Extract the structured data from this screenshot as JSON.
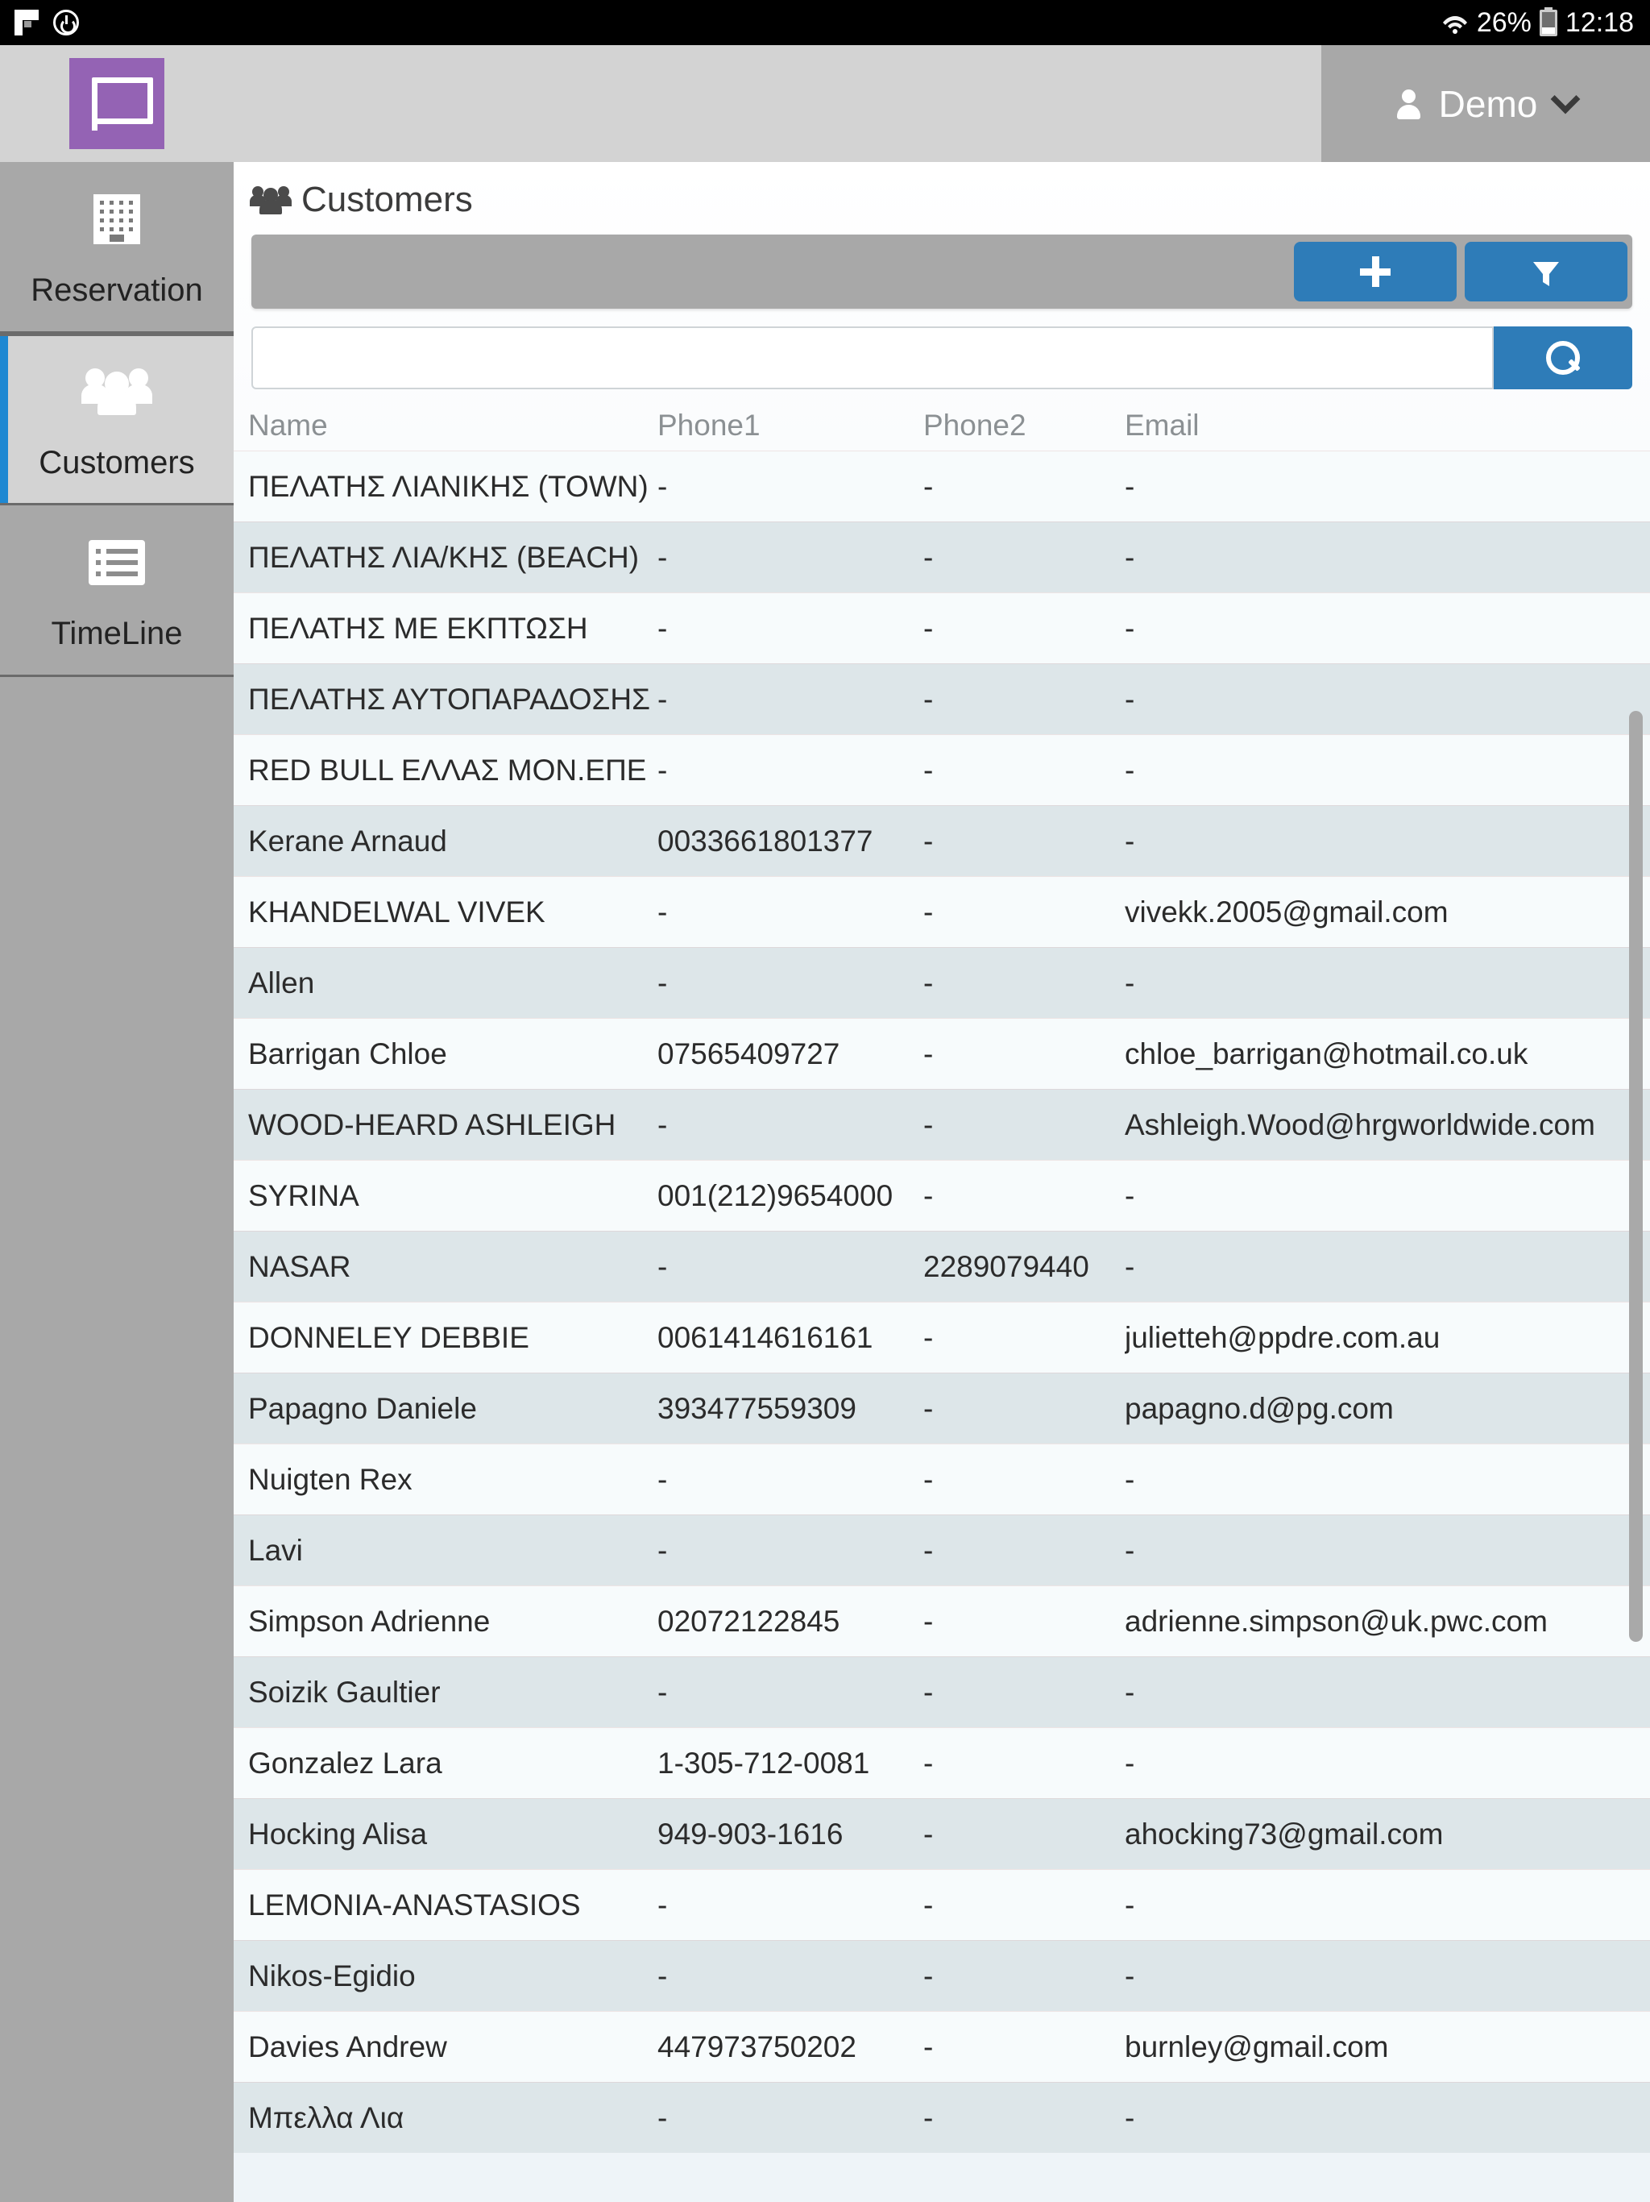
{
  "statusbar": {
    "battery_percent": "26%",
    "time": "12:18",
    "icons": [
      "flag-icon",
      "power-sync-icon",
      "wifi-icon",
      "battery-icon"
    ]
  },
  "appbar": {
    "logo_name": "app-logo",
    "user_label": "Demo",
    "dropdown_icon": "chevron-down-icon"
  },
  "sidebar": {
    "items": [
      {
        "label": "Reservation",
        "icon": "building-icon",
        "active": false
      },
      {
        "label": "Customers",
        "icon": "people-icon",
        "active": true
      },
      {
        "label": "TimeLine",
        "icon": "list-icon",
        "active": false
      }
    ]
  },
  "page": {
    "title": "Customers",
    "title_icon": "people-icon"
  },
  "toolbar": {
    "add_label": "+",
    "add_icon": "plus-icon",
    "filter_icon": "funnel-icon",
    "accent_color": "#2e7cb8"
  },
  "search": {
    "value": "",
    "placeholder": "",
    "button_icon": "search-icon"
  },
  "table": {
    "columns": [
      "Name",
      "Phone1",
      "Phone2",
      "Email"
    ],
    "empty_value": "-",
    "rows": [
      {
        "name": "ΠΕΛΑΤΗΣ ΛΙΑΝΙΚΗΣ (TOWN)",
        "phone1": "-",
        "phone2": "-",
        "email": "-"
      },
      {
        "name": "ΠΕΛΑΤΗΣ ΛΙΑ/ΚΗΣ (BEACH)",
        "phone1": "-",
        "phone2": "-",
        "email": "-"
      },
      {
        "name": "ΠΕΛΑΤΗΣ ΜΕ ΕΚΠΤΩΣΗ",
        "phone1": "-",
        "phone2": "-",
        "email": "-"
      },
      {
        "name": "ΠΕΛΑΤΗΣ ΑΥΤΟΠΑΡΑΔΟΣΗΣ",
        "phone1": "-",
        "phone2": "-",
        "email": "-"
      },
      {
        "name": "RED BULL ΕΛΛΑΣ ΜΟΝ.ΕΠΕ",
        "phone1": "-",
        "phone2": "-",
        "email": "-"
      },
      {
        "name": "Kerane Arnaud",
        "phone1": "0033661801377",
        "phone2": "-",
        "email": "-"
      },
      {
        "name": "KHANDELWAL VIVEK",
        "phone1": "-",
        "phone2": "-",
        "email": "vivekk.2005@gmail.com"
      },
      {
        "name": "Allen",
        "phone1": "-",
        "phone2": "-",
        "email": "-"
      },
      {
        "name": "Barrigan Chloe",
        "phone1": "07565409727",
        "phone2": "-",
        "email": "chloe_barrigan@hotmail.co.uk"
      },
      {
        "name": "WOOD-HEARD ASHLEIGH",
        "phone1": "-",
        "phone2": "-",
        "email": "Ashleigh.Wood@hrgworldwide.com"
      },
      {
        "name": "SYRINA",
        "phone1": "001(212)9654000",
        "phone2": "-",
        "email": "-"
      },
      {
        "name": "NASAR",
        "phone1": "-",
        "phone2": "2289079440",
        "email": "-"
      },
      {
        "name": "DONNELEY DEBBIE",
        "phone1": "0061414616161",
        "phone2": "-",
        "email": "julietteh@ppdre.com.au"
      },
      {
        "name": "Papagno Daniele",
        "phone1": "393477559309",
        "phone2": "-",
        "email": "papagno.d@pg.com"
      },
      {
        "name": "Nuigten Rex",
        "phone1": "-",
        "phone2": "-",
        "email": "-"
      },
      {
        "name": "Lavi",
        "phone1": "-",
        "phone2": "-",
        "email": "-"
      },
      {
        "name": "Simpson Adrienne",
        "phone1": "02072122845",
        "phone2": "-",
        "email": "adrienne.simpson@uk.pwc.com"
      },
      {
        "name": "Soizik Gaultier",
        "phone1": "-",
        "phone2": "-",
        "email": "-"
      },
      {
        "name": "Gonzalez Lara",
        "phone1": "1-305-712-0081",
        "phone2": "-",
        "email": "-"
      },
      {
        "name": "Hocking Alisa",
        "phone1": "949-903-1616",
        "phone2": "-",
        "email": "ahocking73@gmail.com"
      },
      {
        "name": "LEMONIA-ANASTASIOS",
        "phone1": "-",
        "phone2": "-",
        "email": "-"
      },
      {
        "name": "Nikos-Egidio",
        "phone1": "-",
        "phone2": "-",
        "email": "-"
      },
      {
        "name": "Davies Andrew",
        "phone1": "447973750202",
        "phone2": "-",
        "email": "burnley@gmail.com"
      },
      {
        "name": "Μπελλα Λια",
        "phone1": "-",
        "phone2": "-",
        "email": "-"
      }
    ]
  }
}
